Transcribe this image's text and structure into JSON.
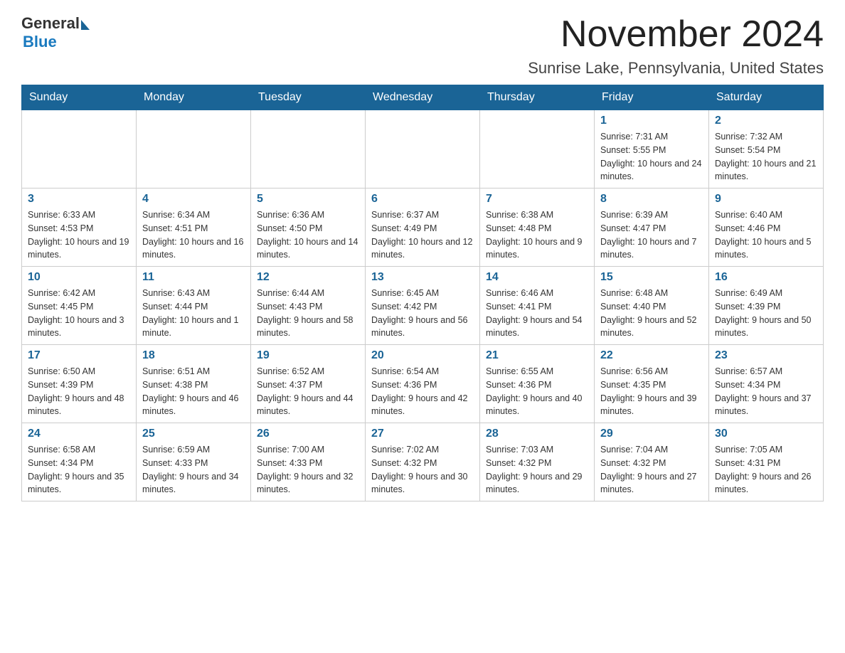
{
  "logo": {
    "general": "General",
    "blue": "Blue"
  },
  "title": "November 2024",
  "location": "Sunrise Lake, Pennsylvania, United States",
  "days_of_week": [
    "Sunday",
    "Monday",
    "Tuesday",
    "Wednesday",
    "Thursday",
    "Friday",
    "Saturday"
  ],
  "weeks": [
    [
      {
        "day": "",
        "sunrise": "",
        "sunset": "",
        "daylight": ""
      },
      {
        "day": "",
        "sunrise": "",
        "sunset": "",
        "daylight": ""
      },
      {
        "day": "",
        "sunrise": "",
        "sunset": "",
        "daylight": ""
      },
      {
        "day": "",
        "sunrise": "",
        "sunset": "",
        "daylight": ""
      },
      {
        "day": "",
        "sunrise": "",
        "sunset": "",
        "daylight": ""
      },
      {
        "day": "1",
        "sunrise": "Sunrise: 7:31 AM",
        "sunset": "Sunset: 5:55 PM",
        "daylight": "Daylight: 10 hours and 24 minutes."
      },
      {
        "day": "2",
        "sunrise": "Sunrise: 7:32 AM",
        "sunset": "Sunset: 5:54 PM",
        "daylight": "Daylight: 10 hours and 21 minutes."
      }
    ],
    [
      {
        "day": "3",
        "sunrise": "Sunrise: 6:33 AM",
        "sunset": "Sunset: 4:53 PM",
        "daylight": "Daylight: 10 hours and 19 minutes."
      },
      {
        "day": "4",
        "sunrise": "Sunrise: 6:34 AM",
        "sunset": "Sunset: 4:51 PM",
        "daylight": "Daylight: 10 hours and 16 minutes."
      },
      {
        "day": "5",
        "sunrise": "Sunrise: 6:36 AM",
        "sunset": "Sunset: 4:50 PM",
        "daylight": "Daylight: 10 hours and 14 minutes."
      },
      {
        "day": "6",
        "sunrise": "Sunrise: 6:37 AM",
        "sunset": "Sunset: 4:49 PM",
        "daylight": "Daylight: 10 hours and 12 minutes."
      },
      {
        "day": "7",
        "sunrise": "Sunrise: 6:38 AM",
        "sunset": "Sunset: 4:48 PM",
        "daylight": "Daylight: 10 hours and 9 minutes."
      },
      {
        "day": "8",
        "sunrise": "Sunrise: 6:39 AM",
        "sunset": "Sunset: 4:47 PM",
        "daylight": "Daylight: 10 hours and 7 minutes."
      },
      {
        "day": "9",
        "sunrise": "Sunrise: 6:40 AM",
        "sunset": "Sunset: 4:46 PM",
        "daylight": "Daylight: 10 hours and 5 minutes."
      }
    ],
    [
      {
        "day": "10",
        "sunrise": "Sunrise: 6:42 AM",
        "sunset": "Sunset: 4:45 PM",
        "daylight": "Daylight: 10 hours and 3 minutes."
      },
      {
        "day": "11",
        "sunrise": "Sunrise: 6:43 AM",
        "sunset": "Sunset: 4:44 PM",
        "daylight": "Daylight: 10 hours and 1 minute."
      },
      {
        "day": "12",
        "sunrise": "Sunrise: 6:44 AM",
        "sunset": "Sunset: 4:43 PM",
        "daylight": "Daylight: 9 hours and 58 minutes."
      },
      {
        "day": "13",
        "sunrise": "Sunrise: 6:45 AM",
        "sunset": "Sunset: 4:42 PM",
        "daylight": "Daylight: 9 hours and 56 minutes."
      },
      {
        "day": "14",
        "sunrise": "Sunrise: 6:46 AM",
        "sunset": "Sunset: 4:41 PM",
        "daylight": "Daylight: 9 hours and 54 minutes."
      },
      {
        "day": "15",
        "sunrise": "Sunrise: 6:48 AM",
        "sunset": "Sunset: 4:40 PM",
        "daylight": "Daylight: 9 hours and 52 minutes."
      },
      {
        "day": "16",
        "sunrise": "Sunrise: 6:49 AM",
        "sunset": "Sunset: 4:39 PM",
        "daylight": "Daylight: 9 hours and 50 minutes."
      }
    ],
    [
      {
        "day": "17",
        "sunrise": "Sunrise: 6:50 AM",
        "sunset": "Sunset: 4:39 PM",
        "daylight": "Daylight: 9 hours and 48 minutes."
      },
      {
        "day": "18",
        "sunrise": "Sunrise: 6:51 AM",
        "sunset": "Sunset: 4:38 PM",
        "daylight": "Daylight: 9 hours and 46 minutes."
      },
      {
        "day": "19",
        "sunrise": "Sunrise: 6:52 AM",
        "sunset": "Sunset: 4:37 PM",
        "daylight": "Daylight: 9 hours and 44 minutes."
      },
      {
        "day": "20",
        "sunrise": "Sunrise: 6:54 AM",
        "sunset": "Sunset: 4:36 PM",
        "daylight": "Daylight: 9 hours and 42 minutes."
      },
      {
        "day": "21",
        "sunrise": "Sunrise: 6:55 AM",
        "sunset": "Sunset: 4:36 PM",
        "daylight": "Daylight: 9 hours and 40 minutes."
      },
      {
        "day": "22",
        "sunrise": "Sunrise: 6:56 AM",
        "sunset": "Sunset: 4:35 PM",
        "daylight": "Daylight: 9 hours and 39 minutes."
      },
      {
        "day": "23",
        "sunrise": "Sunrise: 6:57 AM",
        "sunset": "Sunset: 4:34 PM",
        "daylight": "Daylight: 9 hours and 37 minutes."
      }
    ],
    [
      {
        "day": "24",
        "sunrise": "Sunrise: 6:58 AM",
        "sunset": "Sunset: 4:34 PM",
        "daylight": "Daylight: 9 hours and 35 minutes."
      },
      {
        "day": "25",
        "sunrise": "Sunrise: 6:59 AM",
        "sunset": "Sunset: 4:33 PM",
        "daylight": "Daylight: 9 hours and 34 minutes."
      },
      {
        "day": "26",
        "sunrise": "Sunrise: 7:00 AM",
        "sunset": "Sunset: 4:33 PM",
        "daylight": "Daylight: 9 hours and 32 minutes."
      },
      {
        "day": "27",
        "sunrise": "Sunrise: 7:02 AM",
        "sunset": "Sunset: 4:32 PM",
        "daylight": "Daylight: 9 hours and 30 minutes."
      },
      {
        "day": "28",
        "sunrise": "Sunrise: 7:03 AM",
        "sunset": "Sunset: 4:32 PM",
        "daylight": "Daylight: 9 hours and 29 minutes."
      },
      {
        "day": "29",
        "sunrise": "Sunrise: 7:04 AM",
        "sunset": "Sunset: 4:32 PM",
        "daylight": "Daylight: 9 hours and 27 minutes."
      },
      {
        "day": "30",
        "sunrise": "Sunrise: 7:05 AM",
        "sunset": "Sunset: 4:31 PM",
        "daylight": "Daylight: 9 hours and 26 minutes."
      }
    ]
  ]
}
